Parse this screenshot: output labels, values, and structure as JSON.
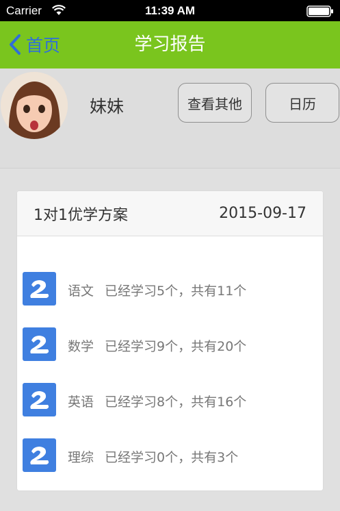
{
  "status_bar": {
    "carrier": "Carrier",
    "time": "11:39 AM"
  },
  "nav": {
    "back_label": "首页",
    "title": "学习报告",
    "accent_color": "#7ac51e",
    "back_color": "#2f6fd8"
  },
  "profile": {
    "name": "妹妹",
    "view_others_label": "查看其他",
    "calendar_label": "日历"
  },
  "plan": {
    "title": "1对1优学方案",
    "date": "2015-09-17",
    "subjects": [
      {
        "subject": "语文",
        "progress": "已经学习5个，共有11个"
      },
      {
        "subject": "数学",
        "progress": "已经学习9个，共有20个"
      },
      {
        "subject": "英语",
        "progress": "已经学习8个，共有16个"
      },
      {
        "subject": "理综",
        "progress": "已经学习0个，共有3个"
      }
    ]
  }
}
